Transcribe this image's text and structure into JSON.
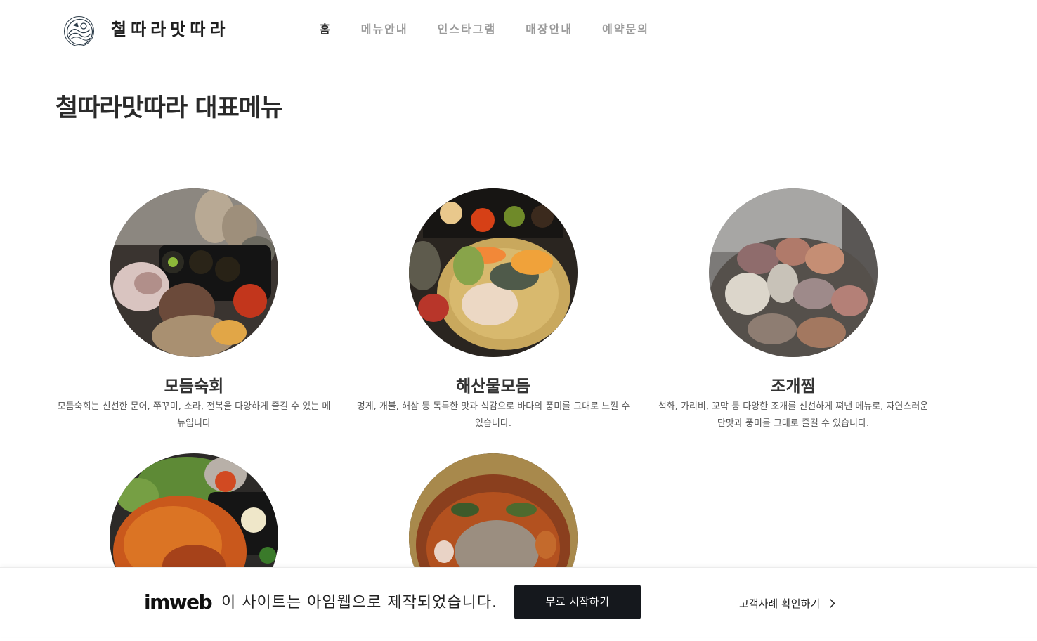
{
  "header": {
    "brand": "철따라맛따라",
    "nav": [
      {
        "label": "홈",
        "active": true
      },
      {
        "label": "메뉴안내",
        "active": false
      },
      {
        "label": "인스타그램",
        "active": false
      },
      {
        "label": "매장안내",
        "active": false
      },
      {
        "label": "예약문의",
        "active": false
      }
    ]
  },
  "section": {
    "title": "철따라맛따라 대표메뉴"
  },
  "menu": [
    {
      "name": "모듬숙회",
      "desc": "모듬숙회는 신선한 문어, 쭈꾸미, 소라, 전복을 다양하게 즐길 수 있는 메뉴입니다",
      "photo": "assorted-boiled-seafood-photo"
    },
    {
      "name": "해산물모듬",
      "desc": "멍게, 개불, 해삼 등 독특한 맛과 식감으로 바다의 풍미를 그대로 느낄 수 있습니다.",
      "photo": "assorted-raw-seafood-photo"
    },
    {
      "name": "조개찜",
      "desc": "석화, 가리비, 꼬막 등 다양한 조개를 신선하게 쪄낸 메뉴로, 자연스러운 단맛과 풍미를 그대로 즐길 수 있습니다.",
      "photo": "steamed-clams-photo"
    },
    {
      "name": "",
      "desc": "",
      "photo": "spicy-stir-fried-dish-photo"
    },
    {
      "name": "",
      "desc": "",
      "photo": "spicy-stew-with-noodles-photo"
    }
  ],
  "banner": {
    "logo": "imweb",
    "text": "이 사이트는 아임웹으로 제작되었습니다.",
    "start_button": "무료 시작하기",
    "cases_link": "고객사례 확인하기"
  },
  "icons": {
    "logo": "restaurant-logo-icon",
    "chevron": "chevron-right-icon"
  }
}
